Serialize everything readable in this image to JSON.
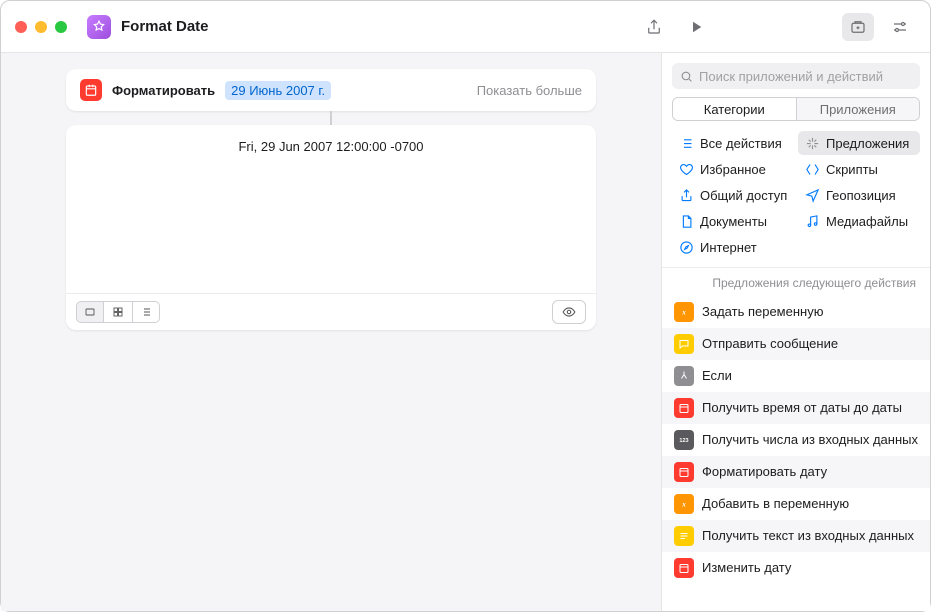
{
  "window": {
    "title": "Format Date"
  },
  "canvas": {
    "action": {
      "label": "Форматировать",
      "token": "29 Июнь 2007 г.",
      "show_more": "Показать больше"
    },
    "output": "Fri, 29 Jun 2007 12:00:00 -0700"
  },
  "inspector": {
    "search_placeholder": "Поиск приложений и действий",
    "tabs": {
      "categories": "Категории",
      "apps": "Приложения"
    },
    "categories": [
      {
        "label": "Все действия",
        "color": "#007aff",
        "icon": "list"
      },
      {
        "label": "Предложения",
        "color": "#8e8e93",
        "icon": "sparkle",
        "selected": true
      },
      {
        "label": "Избранное",
        "color": "#007aff",
        "icon": "heart"
      },
      {
        "label": "Скрипты",
        "color": "#007aff",
        "icon": "script"
      },
      {
        "label": "Общий доступ",
        "color": "#007aff",
        "icon": "share"
      },
      {
        "label": "Геопозиция",
        "color": "#007aff",
        "icon": "location"
      },
      {
        "label": "Документы",
        "color": "#007aff",
        "icon": "doc"
      },
      {
        "label": "Медиафайлы",
        "color": "#007aff",
        "icon": "music"
      },
      {
        "label": "Интернет",
        "color": "#007aff",
        "icon": "safari"
      }
    ],
    "suggestions_header": "Предложения следующего действия",
    "suggestions": [
      {
        "label": "Задать переменную",
        "icon": "var",
        "color": "ic-orange"
      },
      {
        "label": "Отправить сообщение",
        "icon": "msg",
        "color": "ic-yellow"
      },
      {
        "label": "Если",
        "icon": "branch",
        "color": "ic-gray"
      },
      {
        "label": "Получить время от даты до даты",
        "icon": "cal",
        "color": "ic-red"
      },
      {
        "label": "Получить числа из входных данных",
        "icon": "num",
        "color": "ic-darkgray"
      },
      {
        "label": "Форматировать дату",
        "icon": "cal",
        "color": "ic-red"
      },
      {
        "label": "Добавить в переменную",
        "icon": "var",
        "color": "ic-orange"
      },
      {
        "label": "Получить текст из входных данных",
        "icon": "txt",
        "color": "ic-yellow"
      },
      {
        "label": "Изменить дату",
        "icon": "cal",
        "color": "ic-red"
      }
    ]
  }
}
